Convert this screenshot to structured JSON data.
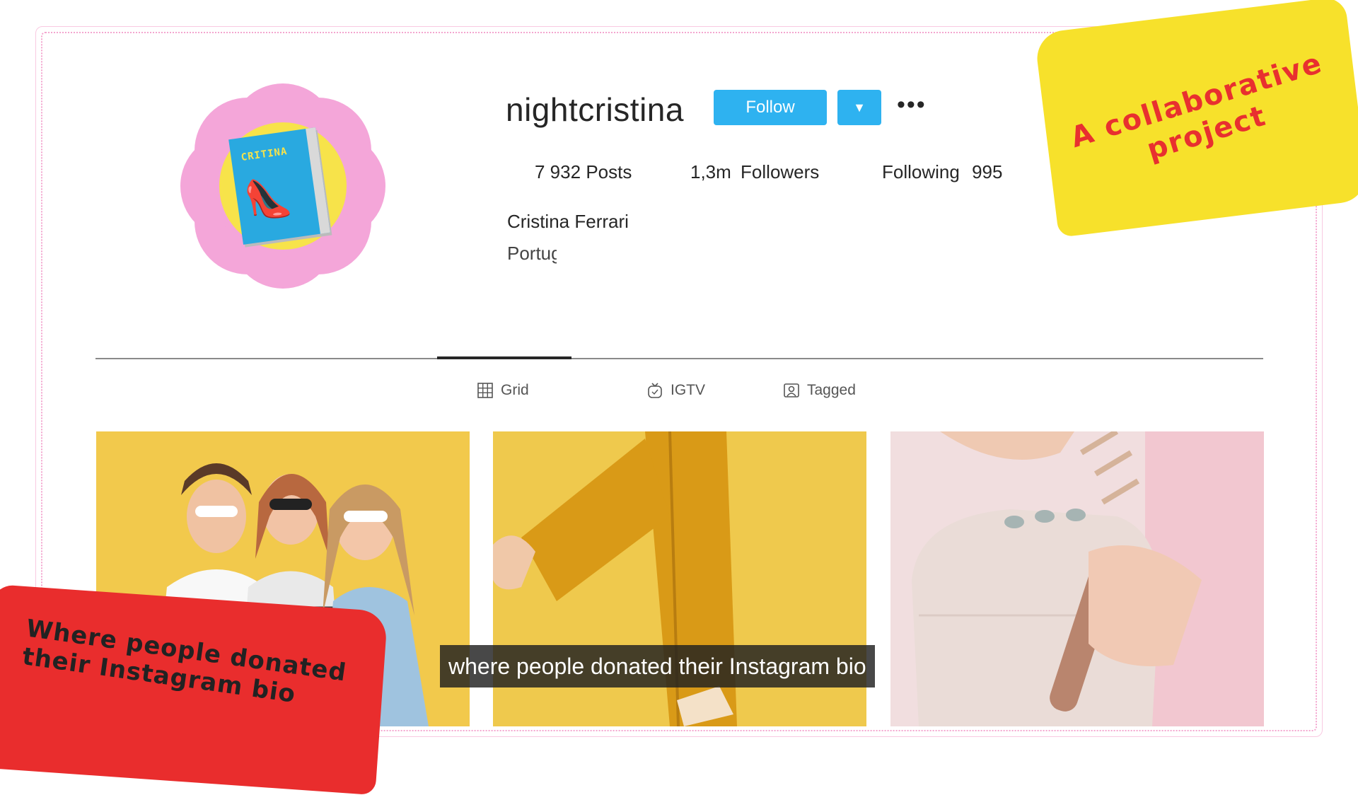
{
  "profile": {
    "username": "nightcristina",
    "follow_label": "Follow",
    "more_label": "•••",
    "posts_count": "7 932",
    "posts_label": "Posts",
    "followers_count": "1,3m",
    "followers_label": "Followers",
    "following_label": "Following",
    "following_count": "995",
    "full_name": "Cristina Ferrari",
    "location": "Portug",
    "avatar_text": "CRITINA"
  },
  "tabs": [
    {
      "label": "Grid",
      "icon": "grid-icon"
    },
    {
      "label": "IGTV",
      "icon": "igtv-icon"
    },
    {
      "label": "Tagged",
      "icon": "tagged-icon"
    }
  ],
  "stickers": {
    "yellow": "A collaborative project",
    "red": "Where people donated their Instagram bio"
  },
  "caption": "where people donated their Instagram bio",
  "colors": {
    "follow_button": "#2eb2f0",
    "frame": "#f4a6cf",
    "sticker_yellow": "#f7e12b",
    "sticker_red": "#e92d2d"
  }
}
